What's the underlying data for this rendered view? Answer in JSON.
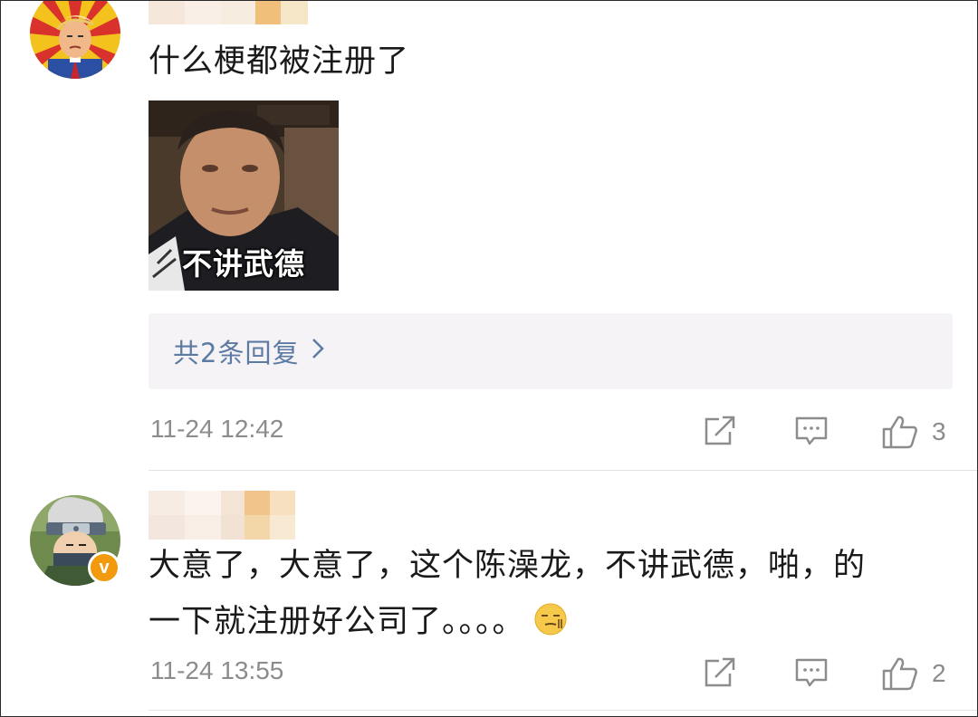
{
  "comments": [
    {
      "text": "什么梗都被注册了",
      "image_caption": "不讲武德",
      "replies_label": "共2条回复",
      "timestamp": "11-24 12:42",
      "likes": "3",
      "avatar_icon": "cartoon-avatar-icon"
    },
    {
      "text_line1": "大意了，大意了，这个陈澡龙，不讲武德，啪，的",
      "text_line2": "一下就注册好公司了。。。。",
      "timestamp": "11-24 13:55",
      "likes": "2",
      "badge": "v",
      "avatar_icon": "ninja-avatar-icon"
    }
  ],
  "icons": {
    "share": "share-icon",
    "reply": "comment-icon",
    "like": "thumbs-up-icon",
    "chevron": "chevron-right-icon"
  },
  "colors": {
    "link": "#5b7ba3",
    "meta": "#8c8c8c",
    "badge": "#f29a0e",
    "replies_bg": "#f6f3f7"
  }
}
